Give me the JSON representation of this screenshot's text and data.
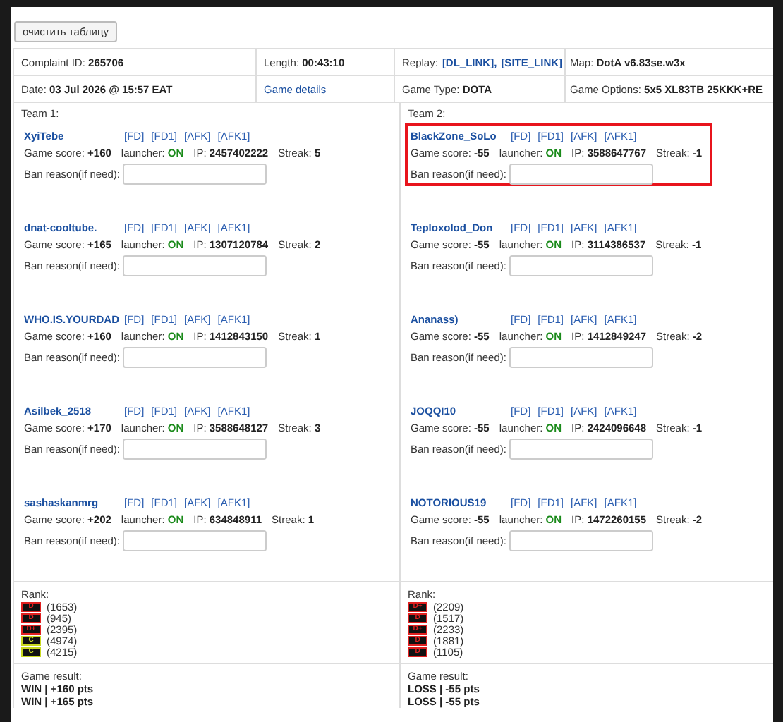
{
  "clear_button": "очистить таблицу",
  "info": [
    [
      {
        "label": "Complaint ID:",
        "value": "265706"
      },
      {
        "label": "Length:",
        "value": "00:43:10"
      },
      {
        "label": "Replay:",
        "links": [
          "[DL_LINK],",
          "[SITE_LINK]"
        ]
      },
      {
        "label": "Map:",
        "value": "DotA v6.83se.w3x"
      }
    ],
    [
      {
        "label": "Date:",
        "value": "03 Jul 2026 @ 15:57 EAT"
      },
      {
        "link": "Game details"
      },
      {
        "label": "Game Type:",
        "value": "DOTA"
      },
      {
        "label": "Game Options:",
        "value": "5x5 XL83TB 25KKK+RE"
      }
    ]
  ],
  "teams": [
    {
      "title": "Team 1:",
      "players": [
        {
          "name": "XyiTebe",
          "flags": [
            "[FD]",
            "[FD1]",
            "[AFK]",
            "[AFK1]"
          ],
          "score_label": "Game score:",
          "score": "+160",
          "launcher_label": "launcher:",
          "launcher": "ON",
          "launcher_on": true,
          "ip_label": "IP:",
          "ip": "2457402222",
          "streak_label": "Streak:",
          "streak": "5",
          "ban_label": "Ban reason(if need):",
          "highlighted": false
        },
        {
          "name": "dnat-cooltube.",
          "flags": [
            "[FD]",
            "[FD1]",
            "[AFK]",
            "[AFK1]"
          ],
          "score_label": "Game score:",
          "score": "+165",
          "launcher_label": "launcher:",
          "launcher": "ON",
          "launcher_on": true,
          "ip_label": "IP:",
          "ip": "1307120784",
          "streak_label": "Streak:",
          "streak": "2",
          "ban_label": "Ban reason(if need):",
          "highlighted": false
        },
        {
          "name": "WHO.IS.YOURDAD",
          "flags": [
            "[FD]",
            "[FD1]",
            "[AFK]",
            "[AFK1]"
          ],
          "score_label": "Game score:",
          "score": "+160",
          "launcher_label": "launcher:",
          "launcher": "ON",
          "launcher_on": true,
          "ip_label": "IP:",
          "ip": "1412843150",
          "streak_label": "Streak:",
          "streak": "1",
          "ban_label": "Ban reason(if need):",
          "highlighted": false
        },
        {
          "name": "Asilbek_2518",
          "flags": [
            "[FD]",
            "[FD1]",
            "[AFK]",
            "[AFK1]"
          ],
          "score_label": "Game score:",
          "score": "+170",
          "launcher_label": "launcher:",
          "launcher": "ON",
          "launcher_on": true,
          "ip_label": "IP:",
          "ip": "3588648127",
          "streak_label": "Streak:",
          "streak": "3",
          "ban_label": "Ban reason(if need):",
          "highlighted": false
        },
        {
          "name": "sashaskanmrg",
          "flags": [
            "[FD]",
            "[FD1]",
            "[AFK]",
            "[AFK1]"
          ],
          "score_label": "Game score:",
          "score": "+202",
          "launcher_label": "launcher:",
          "launcher": "ON",
          "launcher_on": true,
          "ip_label": "IP:",
          "ip": "634848911",
          "streak_label": "Streak:",
          "streak": "1",
          "ban_label": "Ban reason(if need):",
          "highlighted": false
        }
      ],
      "rank_label": "Rank:",
      "ranks": [
        {
          "badge": "D",
          "color": "#e02020",
          "rating": "(1653)"
        },
        {
          "badge": "D",
          "color": "#e02020",
          "rating": "(945)"
        },
        {
          "badge": "D+",
          "color": "#e02020",
          "rating": "(2395)"
        },
        {
          "badge": "C",
          "color": "#c8d820",
          "rating": "(4974)"
        },
        {
          "badge": "C",
          "color": "#c8d820",
          "rating": "(4215)"
        }
      ],
      "result_label": "Game result:",
      "results": [
        "WIN | +160 pts",
        "WIN | +165 pts"
      ]
    },
    {
      "title": "Team 2:",
      "players": [
        {
          "name": "BlackZone_SoLo",
          "flags": [
            "[FD]",
            "[FD1]",
            "[AFK]",
            "[AFK1]"
          ],
          "score_label": "Game score:",
          "score": "-55",
          "launcher_label": "launcher:",
          "launcher": "ON",
          "launcher_on": true,
          "ip_label": "IP:",
          "ip": "3588647767",
          "streak_label": "Streak:",
          "streak": "-1",
          "ban_label": "Ban reason(if need):",
          "highlighted": true
        },
        {
          "name": "Teploxolod_Don",
          "flags": [
            "[FD]",
            "[FD1]",
            "[AFK]",
            "[AFK1]"
          ],
          "score_label": "Game score:",
          "score": "-55",
          "launcher_label": "launcher:",
          "launcher": "ON",
          "launcher_on": true,
          "ip_label": "IP:",
          "ip": "3114386537",
          "streak_label": "Streak:",
          "streak": "-1",
          "ban_label": "Ban reason(if need):",
          "highlighted": false
        },
        {
          "name": "Ananass)__",
          "flags": [
            "[FD]",
            "[FD1]",
            "[AFK]",
            "[AFK1]"
          ],
          "score_label": "Game score:",
          "score": "-55",
          "launcher_label": "launcher:",
          "launcher": "ON",
          "launcher_on": true,
          "ip_label": "IP:",
          "ip": "1412849247",
          "streak_label": "Streak:",
          "streak": "-2",
          "ban_label": "Ban reason(if need):",
          "highlighted": false
        },
        {
          "name": "JOQQI10",
          "flags": [
            "[FD]",
            "[FD1]",
            "[AFK]",
            "[AFK1]"
          ],
          "score_label": "Game score:",
          "score": "-55",
          "launcher_label": "launcher:",
          "launcher": "ON",
          "launcher_on": true,
          "ip_label": "IP:",
          "ip": "2424096648",
          "streak_label": "Streak:",
          "streak": "-1",
          "ban_label": "Ban reason(if need):",
          "highlighted": false
        },
        {
          "name": "NOTORIOUS19",
          "flags": [
            "[FD]",
            "[FD1]",
            "[AFK]",
            "[AFK1]"
          ],
          "score_label": "Game score:",
          "score": "-55",
          "launcher_label": "launcher:",
          "launcher": "ON",
          "launcher_on": true,
          "ip_label": "IP:",
          "ip": "1472260155",
          "streak_label": "Streak:",
          "streak": "-2",
          "ban_label": "Ban reason(if need):",
          "highlighted": false
        }
      ],
      "rank_label": "Rank:",
      "ranks": [
        {
          "badge": "D+",
          "color": "#e02020",
          "rating": "(2209)"
        },
        {
          "badge": "D",
          "color": "#e02020",
          "rating": "(1517)"
        },
        {
          "badge": "D+",
          "color": "#e02020",
          "rating": "(2233)"
        },
        {
          "badge": "D",
          "color": "#e02020",
          "rating": "(1881)"
        },
        {
          "badge": "D",
          "color": "#e02020",
          "rating": "(1105)"
        }
      ],
      "result_label": "Game result:",
      "results": [
        "LOSS | -55 pts",
        "LOSS | -55 pts"
      ]
    }
  ]
}
